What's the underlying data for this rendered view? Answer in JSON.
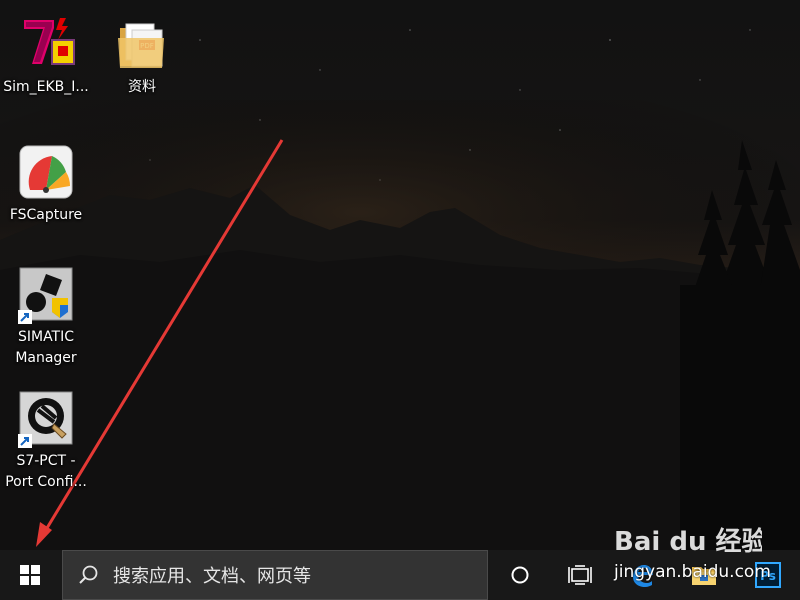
{
  "desktop": {
    "icons": [
      {
        "name": "sim-ekb-install",
        "label": "Sim_EKB_I..."
      },
      {
        "name": "ziliao-folder",
        "label": "资料"
      },
      {
        "name": "fscapture",
        "label": "FSCapture"
      },
      {
        "name": "simatic-manager",
        "label": "SIMATIC\nManager"
      },
      {
        "name": "s7-pct",
        "label": "S7-PCT -\nPort Confi..."
      }
    ]
  },
  "taskbar": {
    "start_icon": "windows-logo-icon",
    "search_placeholder": "搜索应用、文档、网页等",
    "cortana_icon": "cortana-circle-icon",
    "task_view_icon": "task-view-icon",
    "pinned": [
      "edge-icon",
      "file-explorer-icon",
      "photoshop-icon"
    ]
  },
  "watermark": {
    "logo": "Bai du 经验",
    "url": "jingyan.baidu.com"
  },
  "colors": {
    "taskbar_bg": "#181818",
    "search_bg": "#333333",
    "annotation_arrow": "#e53935",
    "photoshop_blue": "#31a8ff"
  }
}
